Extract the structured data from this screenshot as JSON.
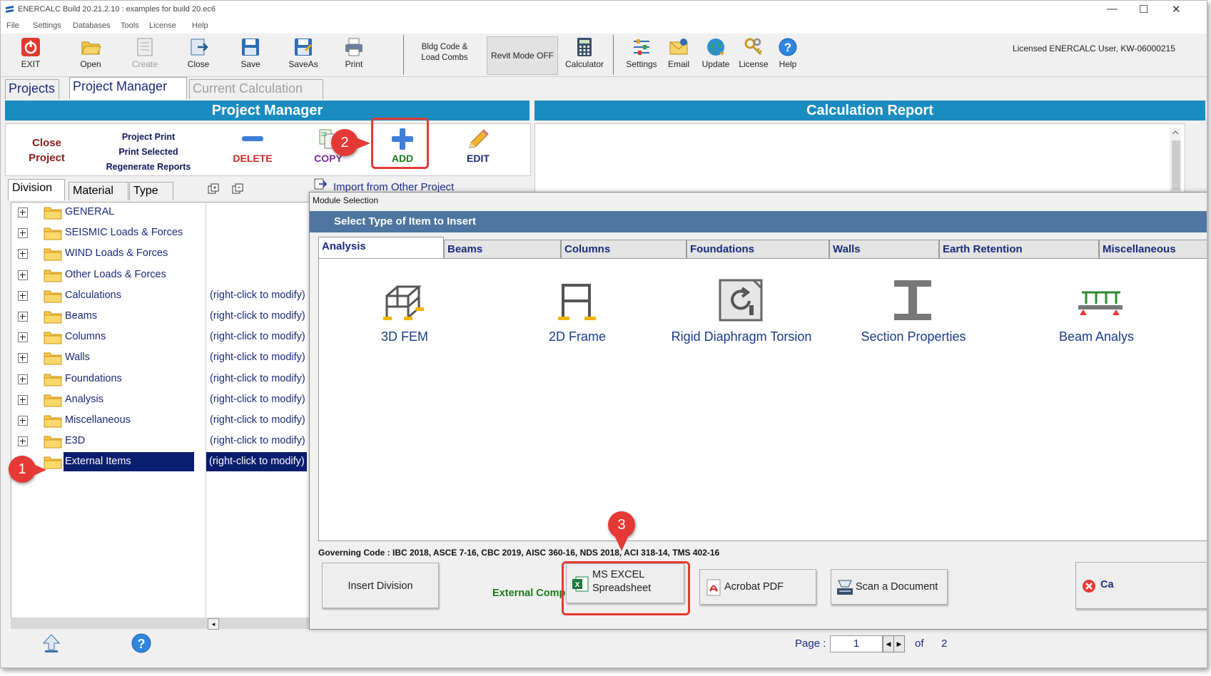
{
  "window": {
    "title": "ENERCALC Build 20.21.2.10 :   examples for build 20.ec6",
    "minimize": "—",
    "maximize": "☐",
    "close": "✕"
  },
  "menu": [
    "File",
    "Settings",
    "Databases",
    "Tools",
    "License",
    "Help"
  ],
  "toolbar": {
    "exit": "EXIT",
    "open": "Open",
    "create": "Create",
    "close": "Close",
    "save": "Save",
    "saveas": "SaveAs",
    "print": "Print",
    "bldg_code_1": "Bldg Code &",
    "bldg_code_2": "Load Combs",
    "revit_mode": "Revit Mode OFF",
    "calculator": "Calculator",
    "settings": "Settings",
    "email": "Email",
    "update": "Update",
    "license": "License",
    "help": "Help",
    "licensed_user": "Licensed ENERCALC User, KW-06000215"
  },
  "main_tabs": {
    "projects": "Projects",
    "project_manager": "Project Manager",
    "current_calculation": "Current Calculation"
  },
  "project_manager": {
    "header": "Project Manager",
    "close_project_1": "Close",
    "close_project_2": "Project",
    "project_print": "Project Print",
    "print_selected": "Print Selected",
    "regenerate_reports": "Regenerate Reports",
    "delete": "DELETE",
    "copy": "COPY",
    "add": "ADD",
    "edit": "EDIT"
  },
  "report": {
    "header": "Calculation Report"
  },
  "subtabs": {
    "division": "Division",
    "material": "Material",
    "type": "Type"
  },
  "import_link": "Import from Other Project",
  "tree": [
    {
      "name": "GENERAL",
      "mod": ""
    },
    {
      "name": "SEISMIC Loads & Forces",
      "mod": ""
    },
    {
      "name": "WIND Loads & Forces",
      "mod": ""
    },
    {
      "name": "Other Loads & Forces",
      "mod": ""
    },
    {
      "name": "Calculations",
      "mod": "(right-click to modify)"
    },
    {
      "name": "Beams",
      "mod": "(right-click to modify)"
    },
    {
      "name": "Columns",
      "mod": "(right-click to modify)"
    },
    {
      "name": "Walls",
      "mod": "(right-click to modify)"
    },
    {
      "name": "Foundations",
      "mod": "(right-click to modify)"
    },
    {
      "name": "Analysis",
      "mod": "(right-click to modify)"
    },
    {
      "name": "Miscellaneous",
      "mod": "(right-click to modify)"
    },
    {
      "name": "E3D",
      "mod": "(right-click to modify)"
    },
    {
      "name": "External Items",
      "mod": "(right-click to modify)"
    }
  ],
  "pager": {
    "label": "Page :",
    "current": "1",
    "of": "of",
    "total": "2"
  },
  "dialog": {
    "title": "Module Selection",
    "band": "Select Type of Item to Insert",
    "tabs": [
      "Analysis",
      "Beams",
      "Columns",
      "Foundations",
      "Walls",
      "Earth Retention",
      "Miscellaneous"
    ],
    "modules": [
      "3D FEM",
      "2D Frame",
      "Rigid Diaphragm Torsion",
      "Section Properties",
      "Beam Analys"
    ],
    "governing_code": "Governing Code : IBC 2018, ASCE 7-16, CBC 2019, AISC 360-16, NDS 2018, ACI 318-14, TMS 402-16",
    "insert_division": "Insert Division",
    "external_components": "External Components :",
    "ms_excel_1": "MS EXCEL",
    "ms_excel_2": "Spreadsheet",
    "acrobat_pdf": "Acrobat PDF",
    "scan_document": "Scan a Document",
    "cancel": "Ca"
  },
  "callouts": [
    "1",
    "2",
    "3"
  ],
  "colors": {
    "header_blue": "#1a8cbf",
    "selection_navy": "#0b1d6e",
    "callout_red": "#e53935",
    "dialog_band": "#4e76a0"
  }
}
